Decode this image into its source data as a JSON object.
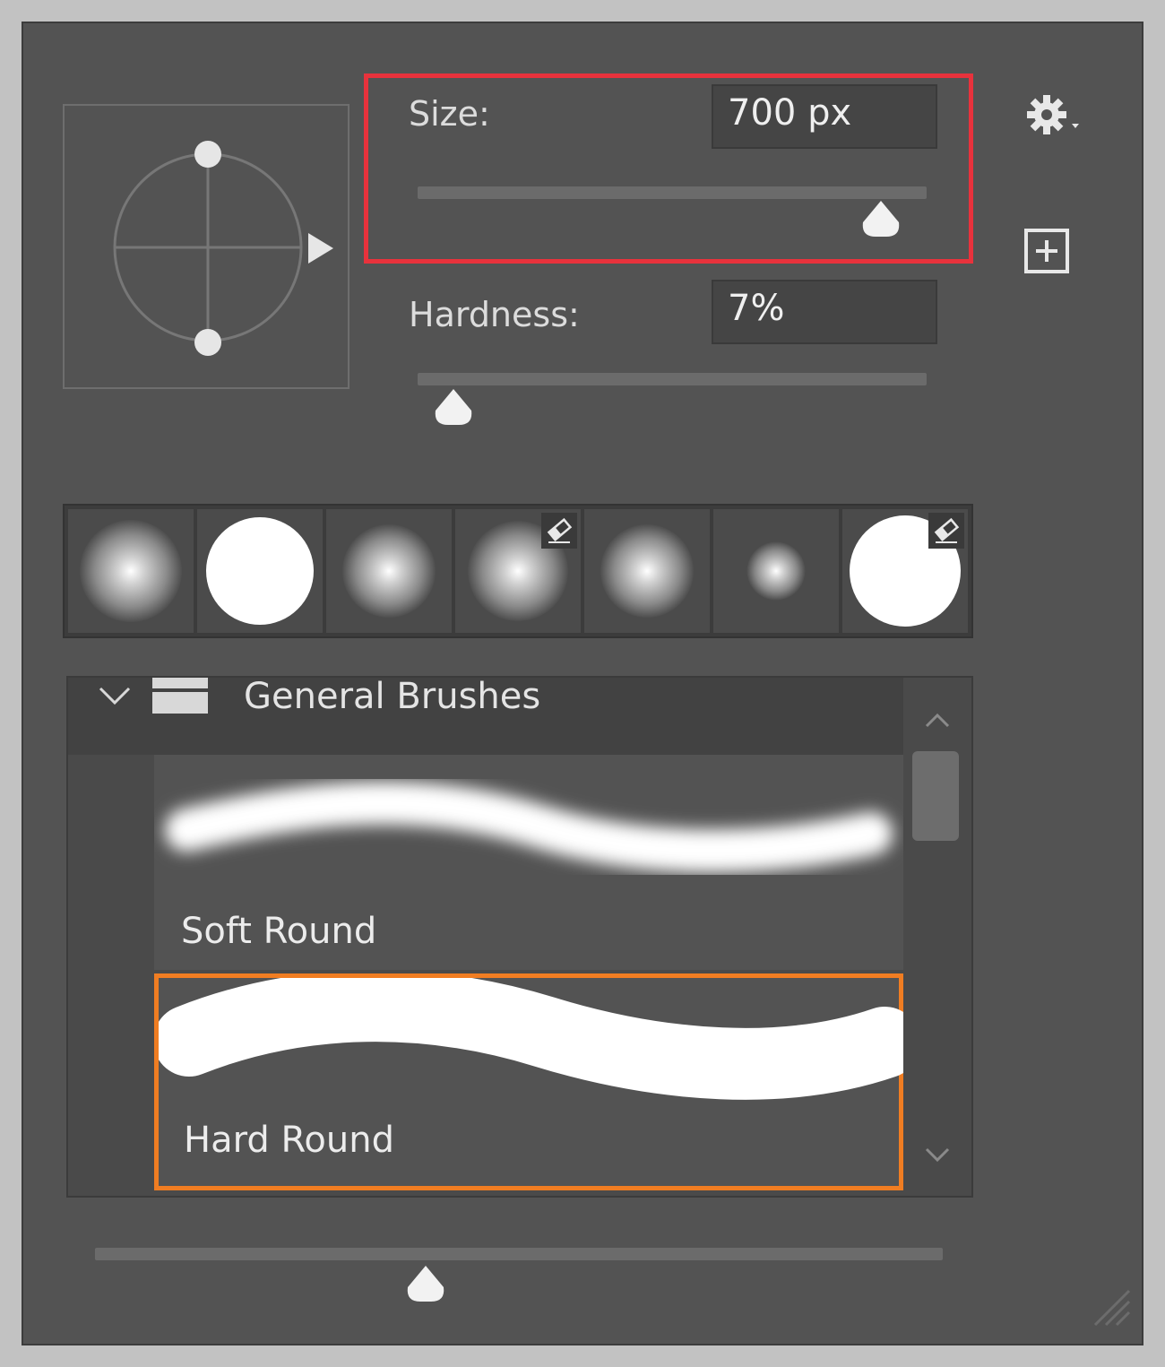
{
  "size": {
    "label": "Size:",
    "value": "700 px",
    "slider_fraction": 0.91
  },
  "hardness": {
    "label": "Hardness:",
    "value": "7%",
    "slider_fraction": 0.07
  },
  "brush_presets": [
    {
      "name": "soft-round-large",
      "type": "soft"
    },
    {
      "name": "hard-round",
      "type": "hard"
    },
    {
      "name": "soft-round-medium",
      "type": "soft"
    },
    {
      "name": "soft-round-eraser",
      "type": "soft",
      "eraser": true
    },
    {
      "name": "soft-round-medium-2",
      "type": "soft"
    },
    {
      "name": "soft-round-small",
      "type": "soft"
    },
    {
      "name": "hard-round-eraser",
      "type": "hard",
      "eraser": true
    }
  ],
  "brush_list": {
    "group_name": "General Brushes",
    "items": [
      {
        "label": "Soft Round",
        "selected": false
      },
      {
        "label": "Hard Round",
        "selected": true
      }
    ]
  },
  "preview_size_slider_fraction": 0.39,
  "icons": {
    "settings": "gear-icon",
    "new_preset": "plus-square-icon",
    "group_expand": "chevron-down-icon",
    "folder": "folder-icon",
    "scroll_up": "chevron-up-icon",
    "scroll_down": "chevron-down-icon",
    "resize": "resize-grip-icon",
    "eraser": "eraser-icon"
  },
  "colors": {
    "panel_bg": "#535353",
    "highlight_size": "#e8323c",
    "highlight_selected": "#f07d22"
  }
}
